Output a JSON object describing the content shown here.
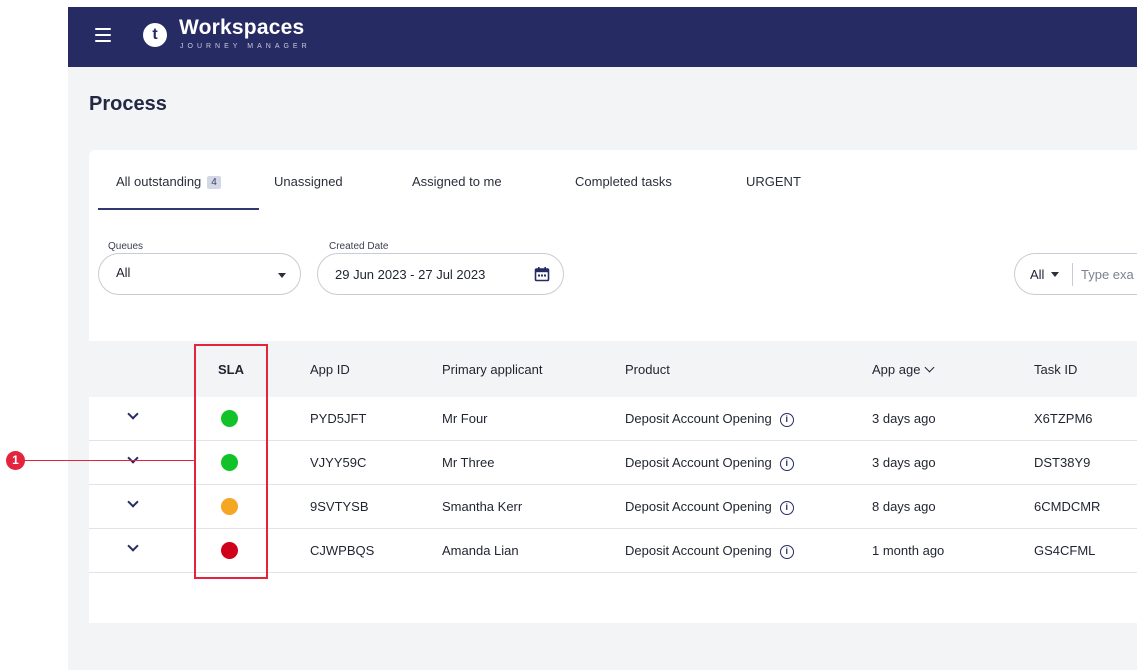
{
  "header": {
    "logo_letter": "t",
    "brand": "Workspaces",
    "brand_sub": "JOURNEY MANAGER"
  },
  "page_title": "Process",
  "tabs": [
    {
      "label": "All outstanding",
      "badge": "4",
      "active": true
    },
    {
      "label": "Unassigned"
    },
    {
      "label": "Assigned to me"
    },
    {
      "label": "Completed tasks"
    },
    {
      "label": "URGENT"
    }
  ],
  "filters": {
    "queues_label": "Queues",
    "queues_value": "All",
    "created_date_label": "Created Date",
    "created_date_value": "29 Jun 2023 - 27 Jul 2023",
    "search_scope": "All",
    "search_placeholder": "Type exa"
  },
  "table": {
    "columns": [
      "SLA",
      "App ID",
      "Primary applicant",
      "Product",
      "App age",
      "Task ID"
    ],
    "rows": [
      {
        "sla": "green",
        "app_id": "PYD5JFT",
        "applicant": "Mr Four",
        "product": "Deposit Account Opening",
        "age": "3 days ago",
        "task_id": "X6TZPM6"
      },
      {
        "sla": "green",
        "app_id": "VJYY59C",
        "applicant": "Mr Three",
        "product": "Deposit Account Opening",
        "age": "3 days ago",
        "task_id": "DST38Y9"
      },
      {
        "sla": "amber",
        "app_id": "9SVTYSB",
        "applicant": "Smantha Kerr",
        "product": "Deposit Account Opening",
        "age": "8 days ago",
        "task_id": "6CMDCMR"
      },
      {
        "sla": "red",
        "app_id": "CJWPBQS",
        "applicant": "Amanda Lian",
        "product": "Deposit Account Opening",
        "age": "1 month ago",
        "task_id": "GS4CFML"
      }
    ]
  },
  "sla_colors": {
    "green": "#12c229",
    "amber": "#f5a623",
    "red": "#d0021b"
  },
  "callout": {
    "number": "1"
  }
}
